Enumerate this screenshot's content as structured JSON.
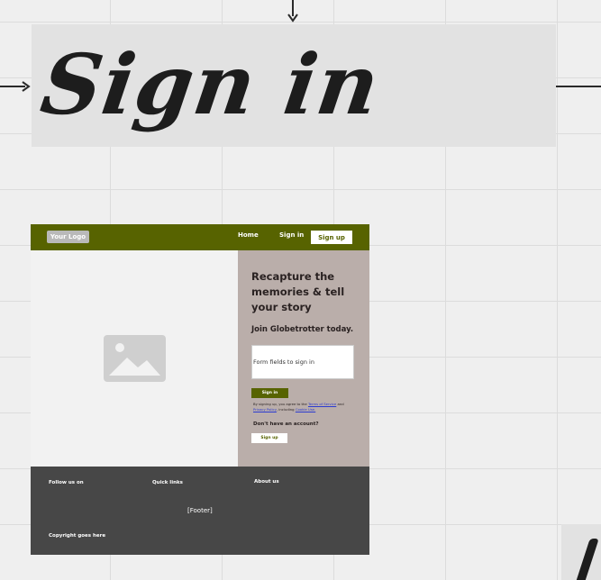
{
  "title_card": {
    "title": "Sign in"
  },
  "nav": {
    "logo": "Your Logo",
    "home": "Home",
    "signin": "Sign in",
    "signup": "Sign up",
    "bg_color": "#576300"
  },
  "hero": {
    "image_icon": "image-placeholder-icon"
  },
  "panel": {
    "headline": "Recapture the memories & tell your story",
    "subhead": "Join Globetrotter today.",
    "form_placeholder": "Form fields to sign in",
    "signin_button": "Sign in",
    "terms_prefix": "By signing up, you agree to the",
    "terms_link": "Terms of Service",
    "terms_and": "and",
    "privacy_link": "Privacy Policy",
    "terms_including": ", including",
    "cookie_link": "Cookie Use.",
    "no_account": "Don't have an account?",
    "signup_button": "Sign up",
    "bg_color": "#baaeaa"
  },
  "footer": {
    "follow": "Follow us on",
    "quick_links": "Quick links",
    "about": "About us",
    "placeholder": "[Footer]",
    "copyright": "Copyright goes here",
    "bg_color": "#474747"
  }
}
